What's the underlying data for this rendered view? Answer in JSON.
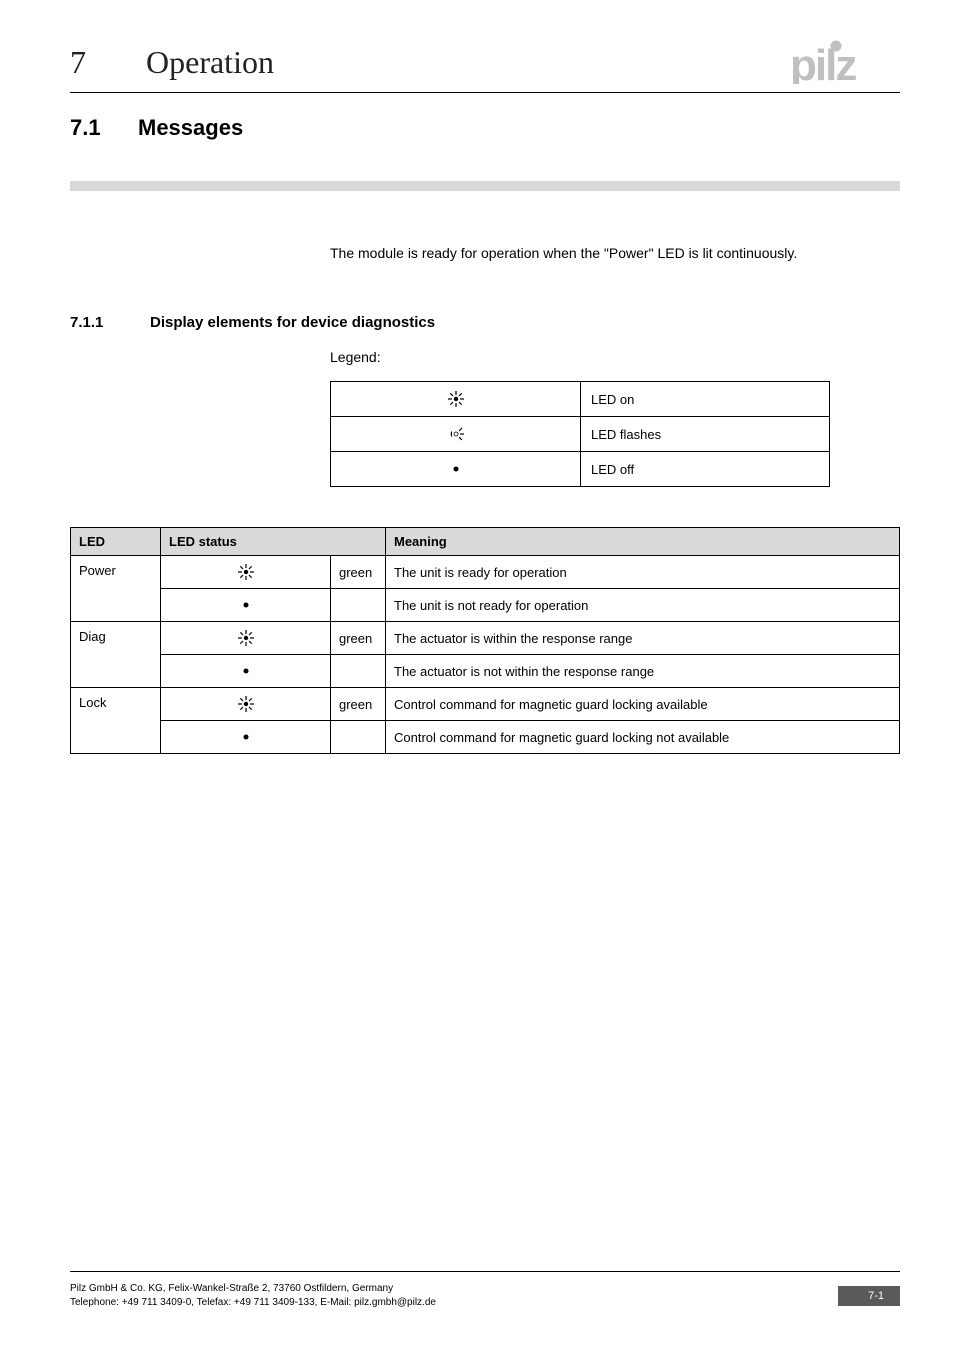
{
  "header": {
    "chapter_num": "7",
    "chapter_title": "Operation",
    "logo_text": "pilz"
  },
  "section": {
    "num": "7.1",
    "title": "Messages"
  },
  "intro_text": "The module is ready for operation when the \"Power\" LED is lit continuously.",
  "subsection": {
    "num": "7.1.1",
    "title": "Display elements for device diagnostics"
  },
  "legend_label": "Legend:",
  "legend": [
    {
      "icon": "led-on",
      "meaning": "LED on"
    },
    {
      "icon": "led-flashes",
      "meaning": "LED flashes"
    },
    {
      "icon": "led-off",
      "meaning": "LED off"
    }
  ],
  "status_headers": {
    "led": "LED",
    "status": "LED status",
    "meaning": "Meaning"
  },
  "status_rows": [
    {
      "led": "Power",
      "icon": "led-on",
      "color": "green",
      "meaning": "The unit is ready for operation"
    },
    {
      "led": "",
      "icon": "led-off",
      "color": "",
      "meaning": "The unit is not ready for operation"
    },
    {
      "led": "Diag",
      "icon": "led-on",
      "color": "green",
      "meaning": "The actuator is within the response range"
    },
    {
      "led": "",
      "icon": "led-off",
      "color": "",
      "meaning": "The actuator is not within the response range"
    },
    {
      "led": "Lock",
      "icon": "led-on",
      "color": "green",
      "meaning": "Control command for magnetic guard locking available"
    },
    {
      "led": "",
      "icon": "led-off",
      "color": "",
      "meaning": "Control command for magnetic guard locking not available"
    }
  ],
  "footer": {
    "line1": "Pilz GmbH & Co. KG, Felix-Wankel-Straße 2, 73760 Ostfildern, Germany",
    "line2": "Telephone: +49 711 3409-0, Telefax: +49 711 3409-133, E-Mail: pilz.gmbh@pilz.de",
    "page": "7-1"
  }
}
